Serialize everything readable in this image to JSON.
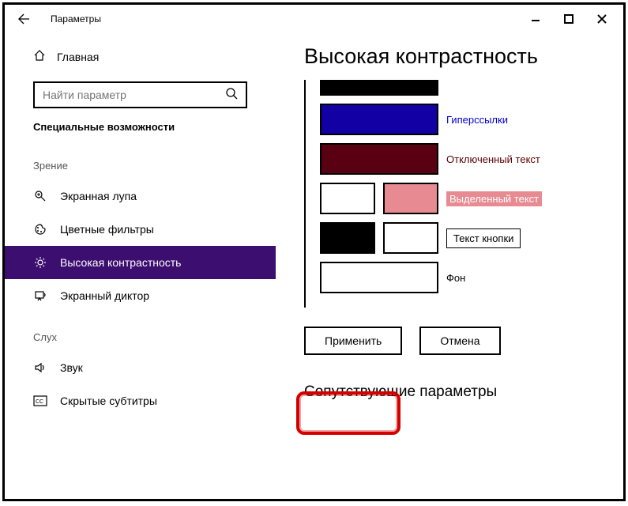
{
  "window": {
    "title": "Параметры"
  },
  "sidebar": {
    "home": "Главная",
    "search_placeholder": "Найти параметр",
    "section": "Специальные возможности",
    "groups": [
      {
        "label": "Зрение",
        "items": [
          {
            "label": "Экранная лупа",
            "icon": "magnifier-icon"
          },
          {
            "label": "Цветные фильтры",
            "icon": "color-palette-icon"
          },
          {
            "label": "Высокая контрастность",
            "icon": "brightness-icon",
            "selected": true
          },
          {
            "label": "Экранный диктор",
            "icon": "narrator-icon"
          }
        ]
      },
      {
        "label": "Слух",
        "items": [
          {
            "label": "Звук",
            "icon": "speaker-icon"
          },
          {
            "label": "Скрытые субтитры",
            "icon": "cc-icon"
          }
        ]
      }
    ]
  },
  "main": {
    "title": "Высокая контрастность",
    "swatches": [
      {
        "type": "single",
        "color": "#000000",
        "label": "",
        "short": true
      },
      {
        "type": "single",
        "color": "#1300a5",
        "label": "Гиперссылки",
        "label_class": "hyperlink"
      },
      {
        "type": "single",
        "color": "#590012",
        "label": "Отключенный текст",
        "label_class": "disabled-text"
      },
      {
        "type": "pair",
        "colors": [
          "#ffffff",
          "#e88a92"
        ],
        "label": "Выделенный текст",
        "label_badge": true
      },
      {
        "type": "pair",
        "colors": [
          "#000000",
          "#ffffff"
        ],
        "label": "Текст кнопки",
        "boxed": true
      },
      {
        "type": "single",
        "color": "#ffffff",
        "label": "Фон"
      }
    ],
    "apply_label": "Применить",
    "cancel_label": "Отмена",
    "related_title": "Сопутствующие параметры"
  }
}
